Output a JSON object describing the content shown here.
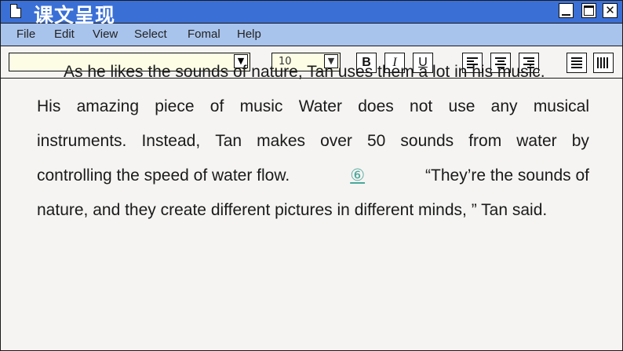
{
  "window": {
    "title": "课文呈现",
    "buttons": {
      "minimize": "",
      "maximize": "",
      "close": "✕"
    }
  },
  "menu": {
    "items": [
      "File",
      "Edit",
      "View",
      "Select",
      "Fomal",
      "Help"
    ]
  },
  "toolbar": {
    "font_value": "",
    "size_value": "10",
    "bold": "B",
    "italic": "I",
    "underline": "U",
    "dropdown_glyph": "▼"
  },
  "document": {
    "paragraph": [
      "As he likes the sounds of nature, Tan uses them a lot in his music.",
      "His amazing piece of music Water does not use any musical",
      "instruments. Instead, Tan makes over 50 sounds from water by",
      "controlling the speed of water flow.",
      "“They’re the sounds of",
      "nature, and they create different pictures in different minds, ” Tan said."
    ],
    "blank_marker": "⑥"
  },
  "colors": {
    "titlebar": "#3a6fd6",
    "menubar": "#a9c4ec",
    "marker": "#4aa79a"
  }
}
